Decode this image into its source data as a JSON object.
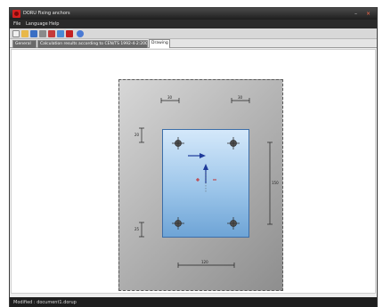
{
  "window": {
    "title": "DORU Fixing anchors",
    "minimize_glyph": "–",
    "close_glyph": "×"
  },
  "menu": {
    "items": [
      "File",
      "Language",
      "Help"
    ]
  },
  "toolbar": {
    "buttons": [
      {
        "icon": "new-document-icon",
        "color": "#f0f0f0"
      },
      {
        "icon": "open-folder-icon",
        "color": "#e8b84a"
      },
      {
        "icon": "save-icon",
        "color": "#3a6fc4"
      },
      {
        "icon": "print-icon",
        "color": "#8a8a8a"
      },
      {
        "icon": "delete-icon",
        "color": "#c43a3a"
      },
      {
        "icon": "properties-icon",
        "color": "#4a8ad4"
      },
      {
        "icon": "pdf-icon",
        "color": "#c42020"
      },
      {
        "icon": "help-icon",
        "color": "#4a7ad4"
      }
    ]
  },
  "tabs": [
    {
      "label": "General",
      "active": false
    },
    {
      "label": "Calculation results according to CEN/TS 1992-4-2:2009",
      "active": false
    },
    {
      "label": "Drawing",
      "active": true
    }
  ],
  "drawing": {
    "dimensions": {
      "top_left": "30",
      "top_right": "30",
      "left_upper": "20",
      "left_lower": "25",
      "right_height": "150",
      "bottom_width": "120"
    },
    "colors": {
      "plate_border": "#5a5a5a",
      "baseplate_border": "#3d6ea8",
      "force_arrow": "#1e3a9a",
      "moment_marker": "#c42020",
      "anchor": "#333333"
    }
  },
  "status": {
    "text": "Modified : document1.dorup"
  }
}
